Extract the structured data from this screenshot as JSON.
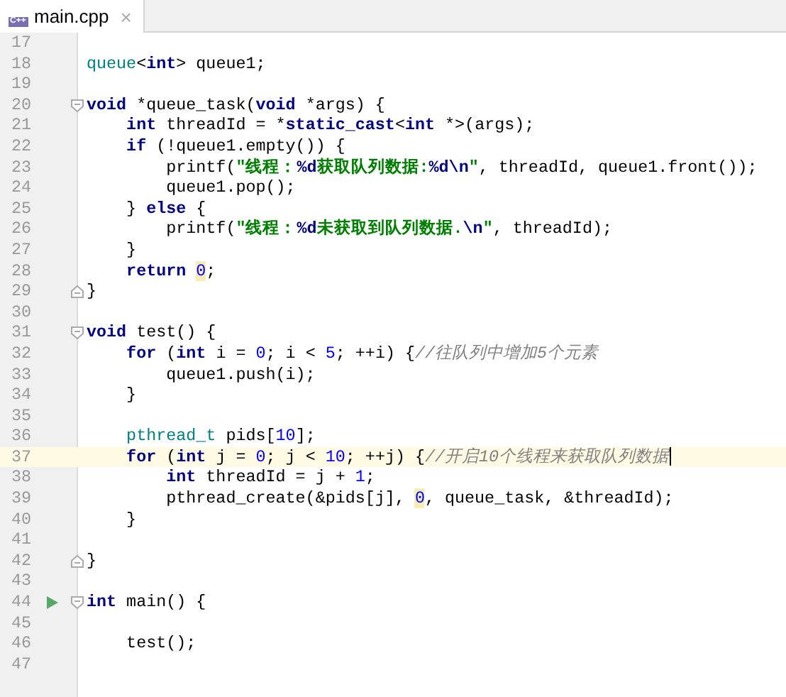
{
  "tabs": [
    {
      "title": "main.cpp",
      "icon_label": "C++",
      "close": "×",
      "selected": true
    }
  ],
  "lines": [
    {
      "number": "17",
      "current": false,
      "run": false,
      "fold_start": false,
      "fold_end": false
    },
    {
      "number": "18",
      "current": false,
      "run": false,
      "fold_start": false,
      "fold_end": false,
      "tokens": [
        {
          "kind": "type",
          "text": "queue"
        },
        {
          "kind": "plain",
          "text": "<"
        },
        {
          "kind": "keyword",
          "text": "int"
        },
        {
          "kind": "plain",
          "text": "> queue1;"
        }
      ]
    },
    {
      "number": "19",
      "current": false,
      "run": false,
      "fold_start": false,
      "fold_end": false
    },
    {
      "number": "20",
      "current": false,
      "run": false,
      "fold_start": true,
      "fold_end": false,
      "tokens": [
        {
          "kind": "keyword",
          "text": "void"
        },
        {
          "kind": "plain",
          "text": " *queue_task("
        },
        {
          "kind": "keyword",
          "text": "void"
        },
        {
          "kind": "plain",
          "text": " *args) {"
        }
      ]
    },
    {
      "number": "21",
      "current": false,
      "run": false,
      "fold_start": false,
      "fold_end": false,
      "tokens": [
        {
          "kind": "keyword",
          "text": "    int"
        },
        {
          "kind": "plain",
          "text": " threadId = *"
        },
        {
          "kind": "keyword",
          "text": "static_cast"
        },
        {
          "kind": "plain",
          "text": "<"
        },
        {
          "kind": "keyword",
          "text": "int"
        },
        {
          "kind": "plain",
          "text": " *>(args);"
        }
      ]
    },
    {
      "number": "22",
      "current": false,
      "run": false,
      "fold_start": false,
      "fold_end": false,
      "tokens": [
        {
          "kind": "keyword",
          "text": "    if"
        },
        {
          "kind": "plain",
          "text": " (!queue1.empty()) {"
        }
      ]
    },
    {
      "number": "23",
      "current": false,
      "run": false,
      "fold_start": false,
      "fold_end": false,
      "tokens": [
        {
          "kind": "plain",
          "text": "        printf("
        },
        {
          "kind": "string",
          "text": "\"线程："
        },
        {
          "kind": "escape",
          "text": "%d"
        },
        {
          "kind": "string",
          "text": "获取队列数据:"
        },
        {
          "kind": "escape",
          "text": "%d\\n"
        },
        {
          "kind": "string",
          "text": "\""
        },
        {
          "kind": "plain",
          "text": ", threadId, queue1.front());"
        }
      ]
    },
    {
      "number": "24",
      "current": false,
      "run": false,
      "fold_start": false,
      "fold_end": false,
      "tokens": [
        {
          "kind": "plain",
          "text": "        queue1.pop();"
        }
      ]
    },
    {
      "number": "25",
      "current": false,
      "run": false,
      "fold_start": false,
      "fold_end": false,
      "tokens": [
        {
          "kind": "plain",
          "text": "    } "
        },
        {
          "kind": "keyword",
          "text": "else"
        },
        {
          "kind": "plain",
          "text": " {"
        }
      ]
    },
    {
      "number": "26",
      "current": false,
      "run": false,
      "fold_start": false,
      "fold_end": false,
      "tokens": [
        {
          "kind": "plain",
          "text": "        printf("
        },
        {
          "kind": "string",
          "text": "\"线程："
        },
        {
          "kind": "escape",
          "text": "%d"
        },
        {
          "kind": "string",
          "text": "未获取到队列数据."
        },
        {
          "kind": "escape",
          "text": "\\n"
        },
        {
          "kind": "string",
          "text": "\""
        },
        {
          "kind": "plain",
          "text": ", threadId);"
        }
      ]
    },
    {
      "number": "27",
      "current": false,
      "run": false,
      "fold_start": false,
      "fold_end": false,
      "tokens": [
        {
          "kind": "plain",
          "text": "    }"
        }
      ]
    },
    {
      "number": "28",
      "current": false,
      "run": false,
      "fold_start": false,
      "fold_end": false,
      "tokens": [
        {
          "kind": "keyword",
          "text": "    return "
        },
        {
          "kind": "number-warning",
          "text": "0"
        },
        {
          "kind": "plain",
          "text": ";"
        }
      ]
    },
    {
      "number": "29",
      "current": false,
      "run": false,
      "fold_start": false,
      "fold_end": true,
      "tokens": [
        {
          "kind": "plain",
          "text": "}"
        }
      ]
    },
    {
      "number": "30",
      "current": false,
      "run": false,
      "fold_start": false,
      "fold_end": false
    },
    {
      "number": "31",
      "current": false,
      "run": false,
      "fold_start": true,
      "fold_end": false,
      "tokens": [
        {
          "kind": "keyword",
          "text": "void"
        },
        {
          "kind": "plain",
          "text": " test() {"
        }
      ]
    },
    {
      "number": "32",
      "current": false,
      "run": false,
      "fold_start": false,
      "fold_end": false,
      "tokens": [
        {
          "kind": "keyword",
          "text": "    for"
        },
        {
          "kind": "plain",
          "text": " ("
        },
        {
          "kind": "keyword",
          "text": "int"
        },
        {
          "kind": "plain",
          "text": " i = "
        },
        {
          "kind": "number",
          "text": "0"
        },
        {
          "kind": "plain",
          "text": "; i < "
        },
        {
          "kind": "number",
          "text": "5"
        },
        {
          "kind": "plain",
          "text": "; ++i) {"
        },
        {
          "kind": "comment",
          "text": "//往队列中增加5个元素"
        }
      ]
    },
    {
      "number": "33",
      "current": false,
      "run": false,
      "fold_start": false,
      "fold_end": false,
      "tokens": [
        {
          "kind": "plain",
          "text": "        queue1.push(i);"
        }
      ]
    },
    {
      "number": "34",
      "current": false,
      "run": false,
      "fold_start": false,
      "fold_end": false,
      "tokens": [
        {
          "kind": "plain",
          "text": "    }"
        }
      ]
    },
    {
      "number": "35",
      "current": false,
      "run": false,
      "fold_start": false,
      "fold_end": false
    },
    {
      "number": "36",
      "current": false,
      "run": false,
      "fold_start": false,
      "fold_end": false,
      "tokens": [
        {
          "kind": "type",
          "text": "    pthread_t"
        },
        {
          "kind": "plain",
          "text": " pids["
        },
        {
          "kind": "number",
          "text": "10"
        },
        {
          "kind": "plain",
          "text": "];"
        }
      ]
    },
    {
      "number": "37",
      "current": true,
      "run": false,
      "fold_start": false,
      "fold_end": false,
      "tokens": [
        {
          "kind": "keyword",
          "text": "    for"
        },
        {
          "kind": "plain",
          "text": " ("
        },
        {
          "kind": "keyword",
          "text": "int"
        },
        {
          "kind": "plain",
          "text": " j = "
        },
        {
          "kind": "number",
          "text": "0"
        },
        {
          "kind": "plain",
          "text": "; j < "
        },
        {
          "kind": "number",
          "text": "10"
        },
        {
          "kind": "plain",
          "text": "; ++j) {"
        },
        {
          "kind": "comment",
          "text": "//开启10个线程来获取队列数据"
        }
      ]
    },
    {
      "number": "38",
      "current": false,
      "run": false,
      "fold_start": false,
      "fold_end": false,
      "tokens": [
        {
          "kind": "keyword",
          "text": "        int"
        },
        {
          "kind": "plain",
          "text": " threadId = j + "
        },
        {
          "kind": "number",
          "text": "1"
        },
        {
          "kind": "plain",
          "text": ";"
        }
      ]
    },
    {
      "number": "39",
      "current": false,
      "run": false,
      "fold_start": false,
      "fold_end": false,
      "tokens": [
        {
          "kind": "plain",
          "text": "        pthread_create(&pids[j], "
        },
        {
          "kind": "number-warning",
          "text": "0"
        },
        {
          "kind": "plain",
          "text": ", queue_task, &threadId);"
        }
      ]
    },
    {
      "number": "40",
      "current": false,
      "run": false,
      "fold_start": false,
      "fold_end": false,
      "tokens": [
        {
          "kind": "plain",
          "text": "    }"
        }
      ]
    },
    {
      "number": "41",
      "current": false,
      "run": false,
      "fold_start": false,
      "fold_end": false
    },
    {
      "number": "42",
      "current": false,
      "run": false,
      "fold_start": false,
      "fold_end": true,
      "tokens": [
        {
          "kind": "plain",
          "text": "}"
        }
      ]
    },
    {
      "number": "43",
      "current": false,
      "run": false,
      "fold_start": false,
      "fold_end": false
    },
    {
      "number": "44",
      "current": false,
      "run": true,
      "fold_start": true,
      "fold_end": false,
      "tokens": [
        {
          "kind": "keyword",
          "text": "int"
        },
        {
          "kind": "plain",
          "text": " main() {"
        }
      ]
    },
    {
      "number": "45",
      "current": false,
      "run": false,
      "fold_start": false,
      "fold_end": false
    },
    {
      "number": "46",
      "current": false,
      "run": false,
      "fold_start": false,
      "fold_end": false,
      "tokens": [
        {
          "kind": "plain",
          "text": "    test();"
        }
      ]
    },
    {
      "number": "47",
      "current": false,
      "run": false,
      "fold_start": false,
      "fold_end": false
    }
  ]
}
